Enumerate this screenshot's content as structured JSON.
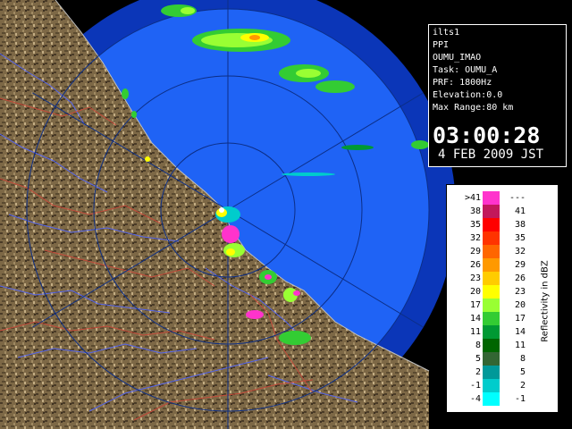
{
  "info": {
    "lines": [
      "ilts1",
      "PPI",
      "OUMU_IMAO",
      "Task: OUMU_A",
      "PRF: 1800Hz",
      "Elevation:0.0",
      "Max Range:80 km"
    ],
    "time": "03:00:28",
    "date": "4 FEB 2009 JST"
  },
  "legend": {
    "label": "Reflectivity in dBZ",
    "rows": [
      {
        "low": ">41",
        "high": "---",
        "color": "#ff33cc"
      },
      {
        "low": "38",
        "high": "41",
        "color": "#c2185b"
      },
      {
        "low": "35",
        "high": "38",
        "color": "#ff0000"
      },
      {
        "low": "32",
        "high": "35",
        "color": "#ff3300"
      },
      {
        "low": "29",
        "high": "32",
        "color": "#ff6600"
      },
      {
        "low": "26",
        "high": "29",
        "color": "#ff9900"
      },
      {
        "low": "23",
        "high": "26",
        "color": "#ffcc00"
      },
      {
        "low": "20",
        "high": "23",
        "color": "#ffff00"
      },
      {
        "low": "17",
        "high": "20",
        "color": "#99ff33"
      },
      {
        "low": "14",
        "high": "17",
        "color": "#33cc33"
      },
      {
        "low": "11",
        "high": "14",
        "color": "#009933"
      },
      {
        "low": "8",
        "high": "11",
        "color": "#006600"
      },
      {
        "low": "5",
        "high": "8",
        "color": "#336633"
      },
      {
        "low": "2",
        "high": "5",
        "color": "#009999"
      },
      {
        "low": "-1",
        "high": "2",
        "color": "#00cccc"
      },
      {
        "low": "-4",
        "high": "-1",
        "color": "#00ffff"
      }
    ]
  },
  "colors": {
    "coverage": "#1f63f5",
    "outer_band": "#0b36b8",
    "land": "#7d6846",
    "land_dark": "#4a3b27",
    "rivers": "#5566ee",
    "boundaries": "#c44a3a"
  }
}
